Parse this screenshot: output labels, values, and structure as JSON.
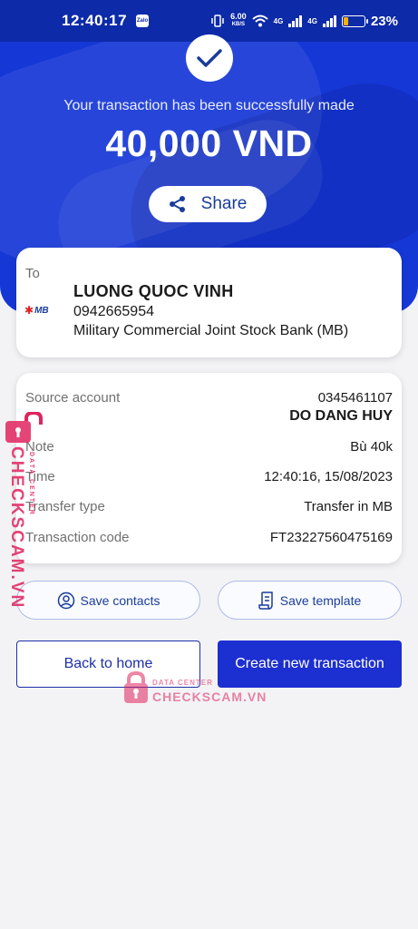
{
  "status_bar": {
    "time": "12:40:17",
    "zalo": "Zalo",
    "net_speed": "6.00",
    "net_unit": "KB/S",
    "network1": "4G",
    "network2": "4G",
    "battery_percent": "23%",
    "battery_level": 0.23
  },
  "colors": {
    "primary": "#1537d6",
    "button_blue": "#1c2fd0",
    "watermark": "#e0245e"
  },
  "header": {
    "success_message": "Your transaction has been successfully made",
    "amount": "40,000 VND",
    "share_label": "Share"
  },
  "recipient": {
    "to_label": "To",
    "bank_logo_text": "MB",
    "name": "LUONG QUOC VINH",
    "account": "0942665954",
    "bank": "Military Commercial Joint Stock Bank (MB)"
  },
  "details": {
    "source_label": "Source account",
    "source_account": "0345461107",
    "source_name": "DO DANG HUY",
    "note_label": "Note",
    "note_value": "Bù 40k",
    "time_label": "Time",
    "time_value": "12:40:16, 15/08/2023",
    "type_label": "Transfer type",
    "type_value": "Transfer in MB",
    "code_label": "Transaction code",
    "code_value": "FT23227560475169"
  },
  "actions": {
    "save_contacts": "Save contacts",
    "save_template": "Save template",
    "back_home": "Back to home",
    "new_transaction": "Create new transaction"
  },
  "watermark": {
    "site": "CHECKSCAM.VN",
    "sub": "DATA CENTER"
  }
}
